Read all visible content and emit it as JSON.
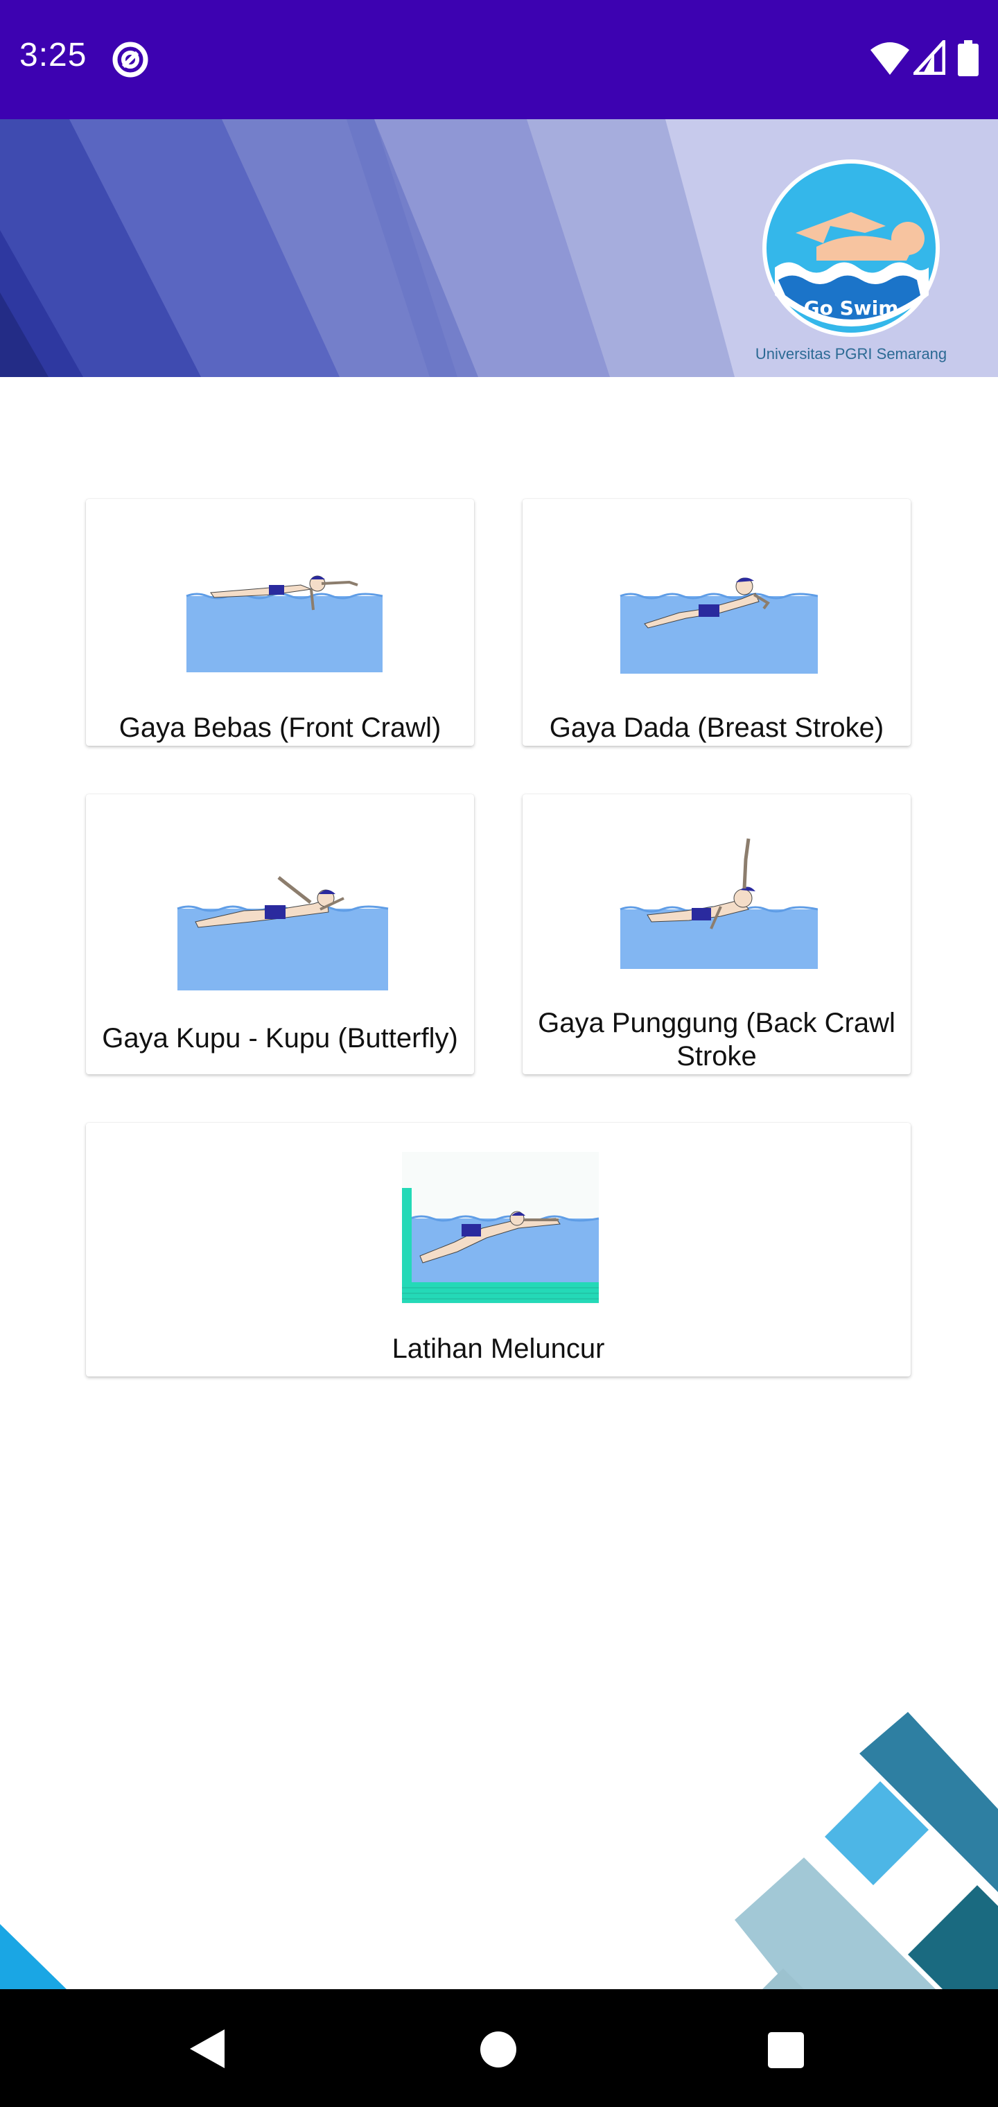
{
  "status_bar": {
    "time": "3:25",
    "background": "#3d02b1"
  },
  "header": {
    "logo_name": "Go Swim",
    "logo_caption": "Universitas PGRI Semarang"
  },
  "menu": {
    "items": [
      {
        "label": "Gaya Bebas (Front Crawl)",
        "icon": "front-crawl-swimmer-illustration"
      },
      {
        "label": "Gaya Dada (Breast Stroke)",
        "icon": "breast-stroke-swimmer-illustration"
      },
      {
        "label": "Gaya Kupu - Kupu (Butterfly)",
        "icon": "butterfly-swimmer-illustration"
      },
      {
        "label": "Gaya Punggung (Back Crawl Stroke",
        "icon": "back-crawl-swimmer-illustration"
      },
      {
        "label": "Latihan Meluncur",
        "icon": "gliding-swimmer-illustration"
      }
    ]
  },
  "navigation": {
    "back": "back-icon",
    "home": "home-icon",
    "recents": "recents-icon"
  },
  "colors": {
    "water": "#82b6f2",
    "wall": "#24d9b7",
    "accent_dark": "#2e7fa2",
    "accent_light": "#4db6e6"
  }
}
